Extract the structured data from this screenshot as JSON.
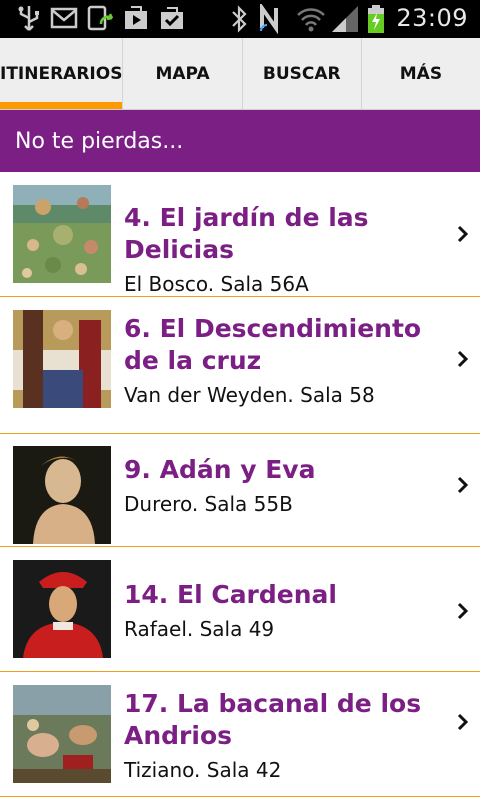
{
  "status_bar": {
    "time": "23:09",
    "icons": [
      "usb-icon",
      "gmail-icon",
      "sync-icon",
      "play-store-icon",
      "tasks-icon",
      "bluetooth-icon",
      "nfc-icon",
      "wifi-icon",
      "signal-icon",
      "battery-charging-icon"
    ]
  },
  "tabs": [
    {
      "label": "ITINERARIOS",
      "active": true
    },
    {
      "label": "MAPA",
      "active": false
    },
    {
      "label": "BUSCAR",
      "active": false
    },
    {
      "label": "MÁS",
      "active": false
    }
  ],
  "section": {
    "title": "No te pierdas..."
  },
  "items": [
    {
      "title": "4. El jardín de las Delicias",
      "subtitle": "El Bosco. Sala 56A"
    },
    {
      "title": "6. El Descendimiento de la cruz",
      "subtitle": "Van der Weyden. Sala 58"
    },
    {
      "title": "9. Adán y Eva",
      "subtitle": "Durero. Sala 55B"
    },
    {
      "title": "14. El Cardenal",
      "subtitle": "Rafael. Sala 49"
    },
    {
      "title": "17. La bacanal de los Andrios",
      "subtitle": "Tiziano. Sala 42"
    }
  ],
  "colors": {
    "accent_purple": "#7b1f85",
    "accent_orange": "#ff9900"
  }
}
